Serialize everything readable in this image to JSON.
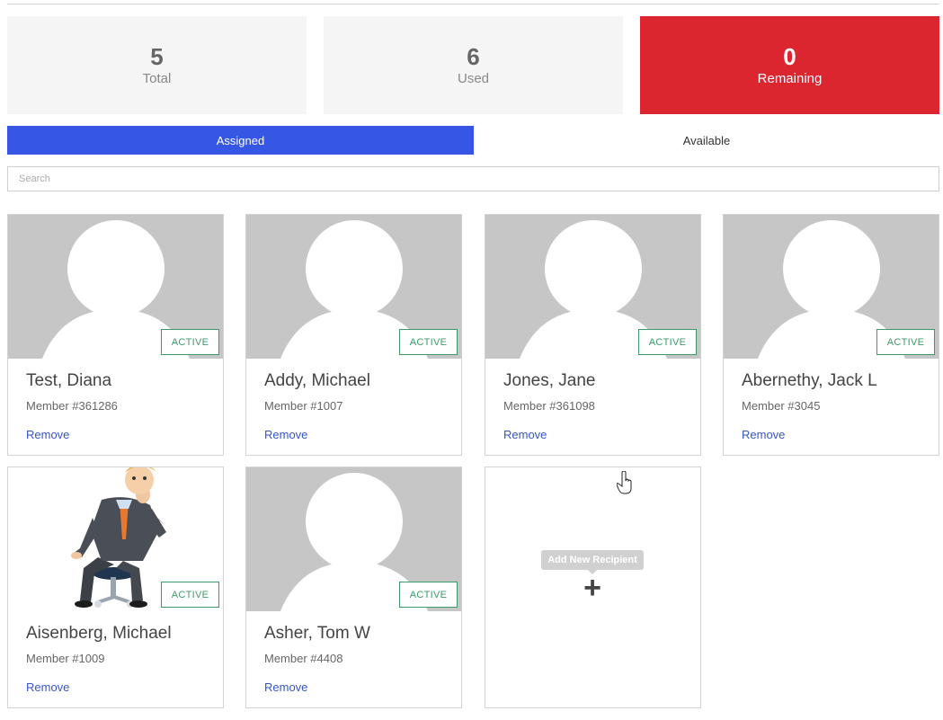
{
  "stats": {
    "total": {
      "value": "5",
      "label": "Total"
    },
    "used": {
      "value": "6",
      "label": "Used"
    },
    "remaining": {
      "value": "0",
      "label": "Remaining"
    }
  },
  "tabs": {
    "assigned": "Assigned",
    "available": "Available"
  },
  "search": {
    "placeholder": "Search",
    "value": ""
  },
  "recipients": [
    {
      "name": "Test, Diana",
      "member": "Member #361286",
      "status": "ACTIVE",
      "remove": "Remove"
    },
    {
      "name": "Addy, Michael",
      "member": "Member #1007",
      "status": "ACTIVE",
      "remove": "Remove"
    },
    {
      "name": "Jones, Jane",
      "member": "Member #361098",
      "status": "ACTIVE",
      "remove": "Remove"
    },
    {
      "name": "Abernethy, Jack L",
      "member": "Member #3045",
      "status": "ACTIVE",
      "remove": "Remove"
    },
    {
      "name": "Aisenberg, Michael",
      "member": "Member #1009",
      "status": "ACTIVE",
      "remove": "Remove"
    },
    {
      "name": "Asher, Tom W",
      "member": "Member #4408",
      "status": "ACTIVE",
      "remove": "Remove"
    }
  ],
  "add_card": {
    "tooltip": "Add New Recipient",
    "icon": "plus-icon"
  },
  "colors": {
    "accent": "#3557e3",
    "remaining_bg": "#dc262f",
    "active_badge": "#3c9a68",
    "link": "#3557c4"
  }
}
